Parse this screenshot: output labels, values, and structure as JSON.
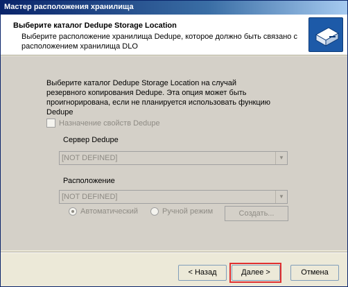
{
  "window": {
    "title": "Мастер расположения хранилища"
  },
  "header": {
    "title": "Выберите каталог Dedupe Storage Location",
    "subtitle": "Выберите расположение хранилища Dedupe, которое должно быть связано с расположением хранилища DLO",
    "icon": "storage-wizard-icon"
  },
  "main": {
    "description": "Выберите каталог Dedupe Storage Location на случай резервного копирования Dedupe. Эта опция может быть проигнорирована, если не планируется использовать функцию Dedupe",
    "checkbox_label": "Назначение свойств Dedupe",
    "server_label": "Сервер Dedupe",
    "server_value": "[NOT DEFINED]",
    "location_label": "Расположение",
    "location_value": "[NOT DEFINED]",
    "radio_auto": "Автоматический",
    "radio_manual": "Ручной режим",
    "create_button": "Создать..."
  },
  "footer": {
    "back_label": "< Назад",
    "next_label": "Далее >",
    "cancel_label": "Отмена"
  },
  "colors": {
    "titlebar": "#0a246a",
    "dialog_bg": "#d4d0c8",
    "highlight": "#e03030"
  }
}
